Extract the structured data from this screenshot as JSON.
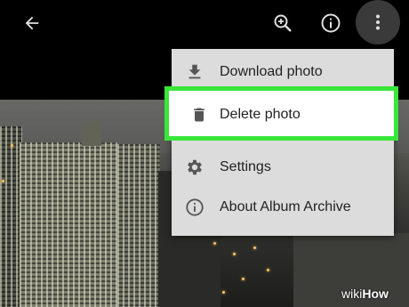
{
  "toolbar": {
    "back_icon": "arrow-back-icon",
    "zoom_icon": "zoom-in-icon",
    "info_icon": "info-icon",
    "more_icon": "more-vert-icon"
  },
  "menu": {
    "items": [
      {
        "label": "Download photo",
        "icon": "download-icon"
      },
      {
        "label": "Delete photo",
        "icon": "trash-icon"
      },
      {
        "label": "Settings",
        "icon": "gear-icon"
      },
      {
        "label": "About Album Archive",
        "icon": "info-icon"
      }
    ]
  },
  "highlight_color": "#39e639",
  "watermark": {
    "wiki": "wiki",
    "how": "How"
  }
}
